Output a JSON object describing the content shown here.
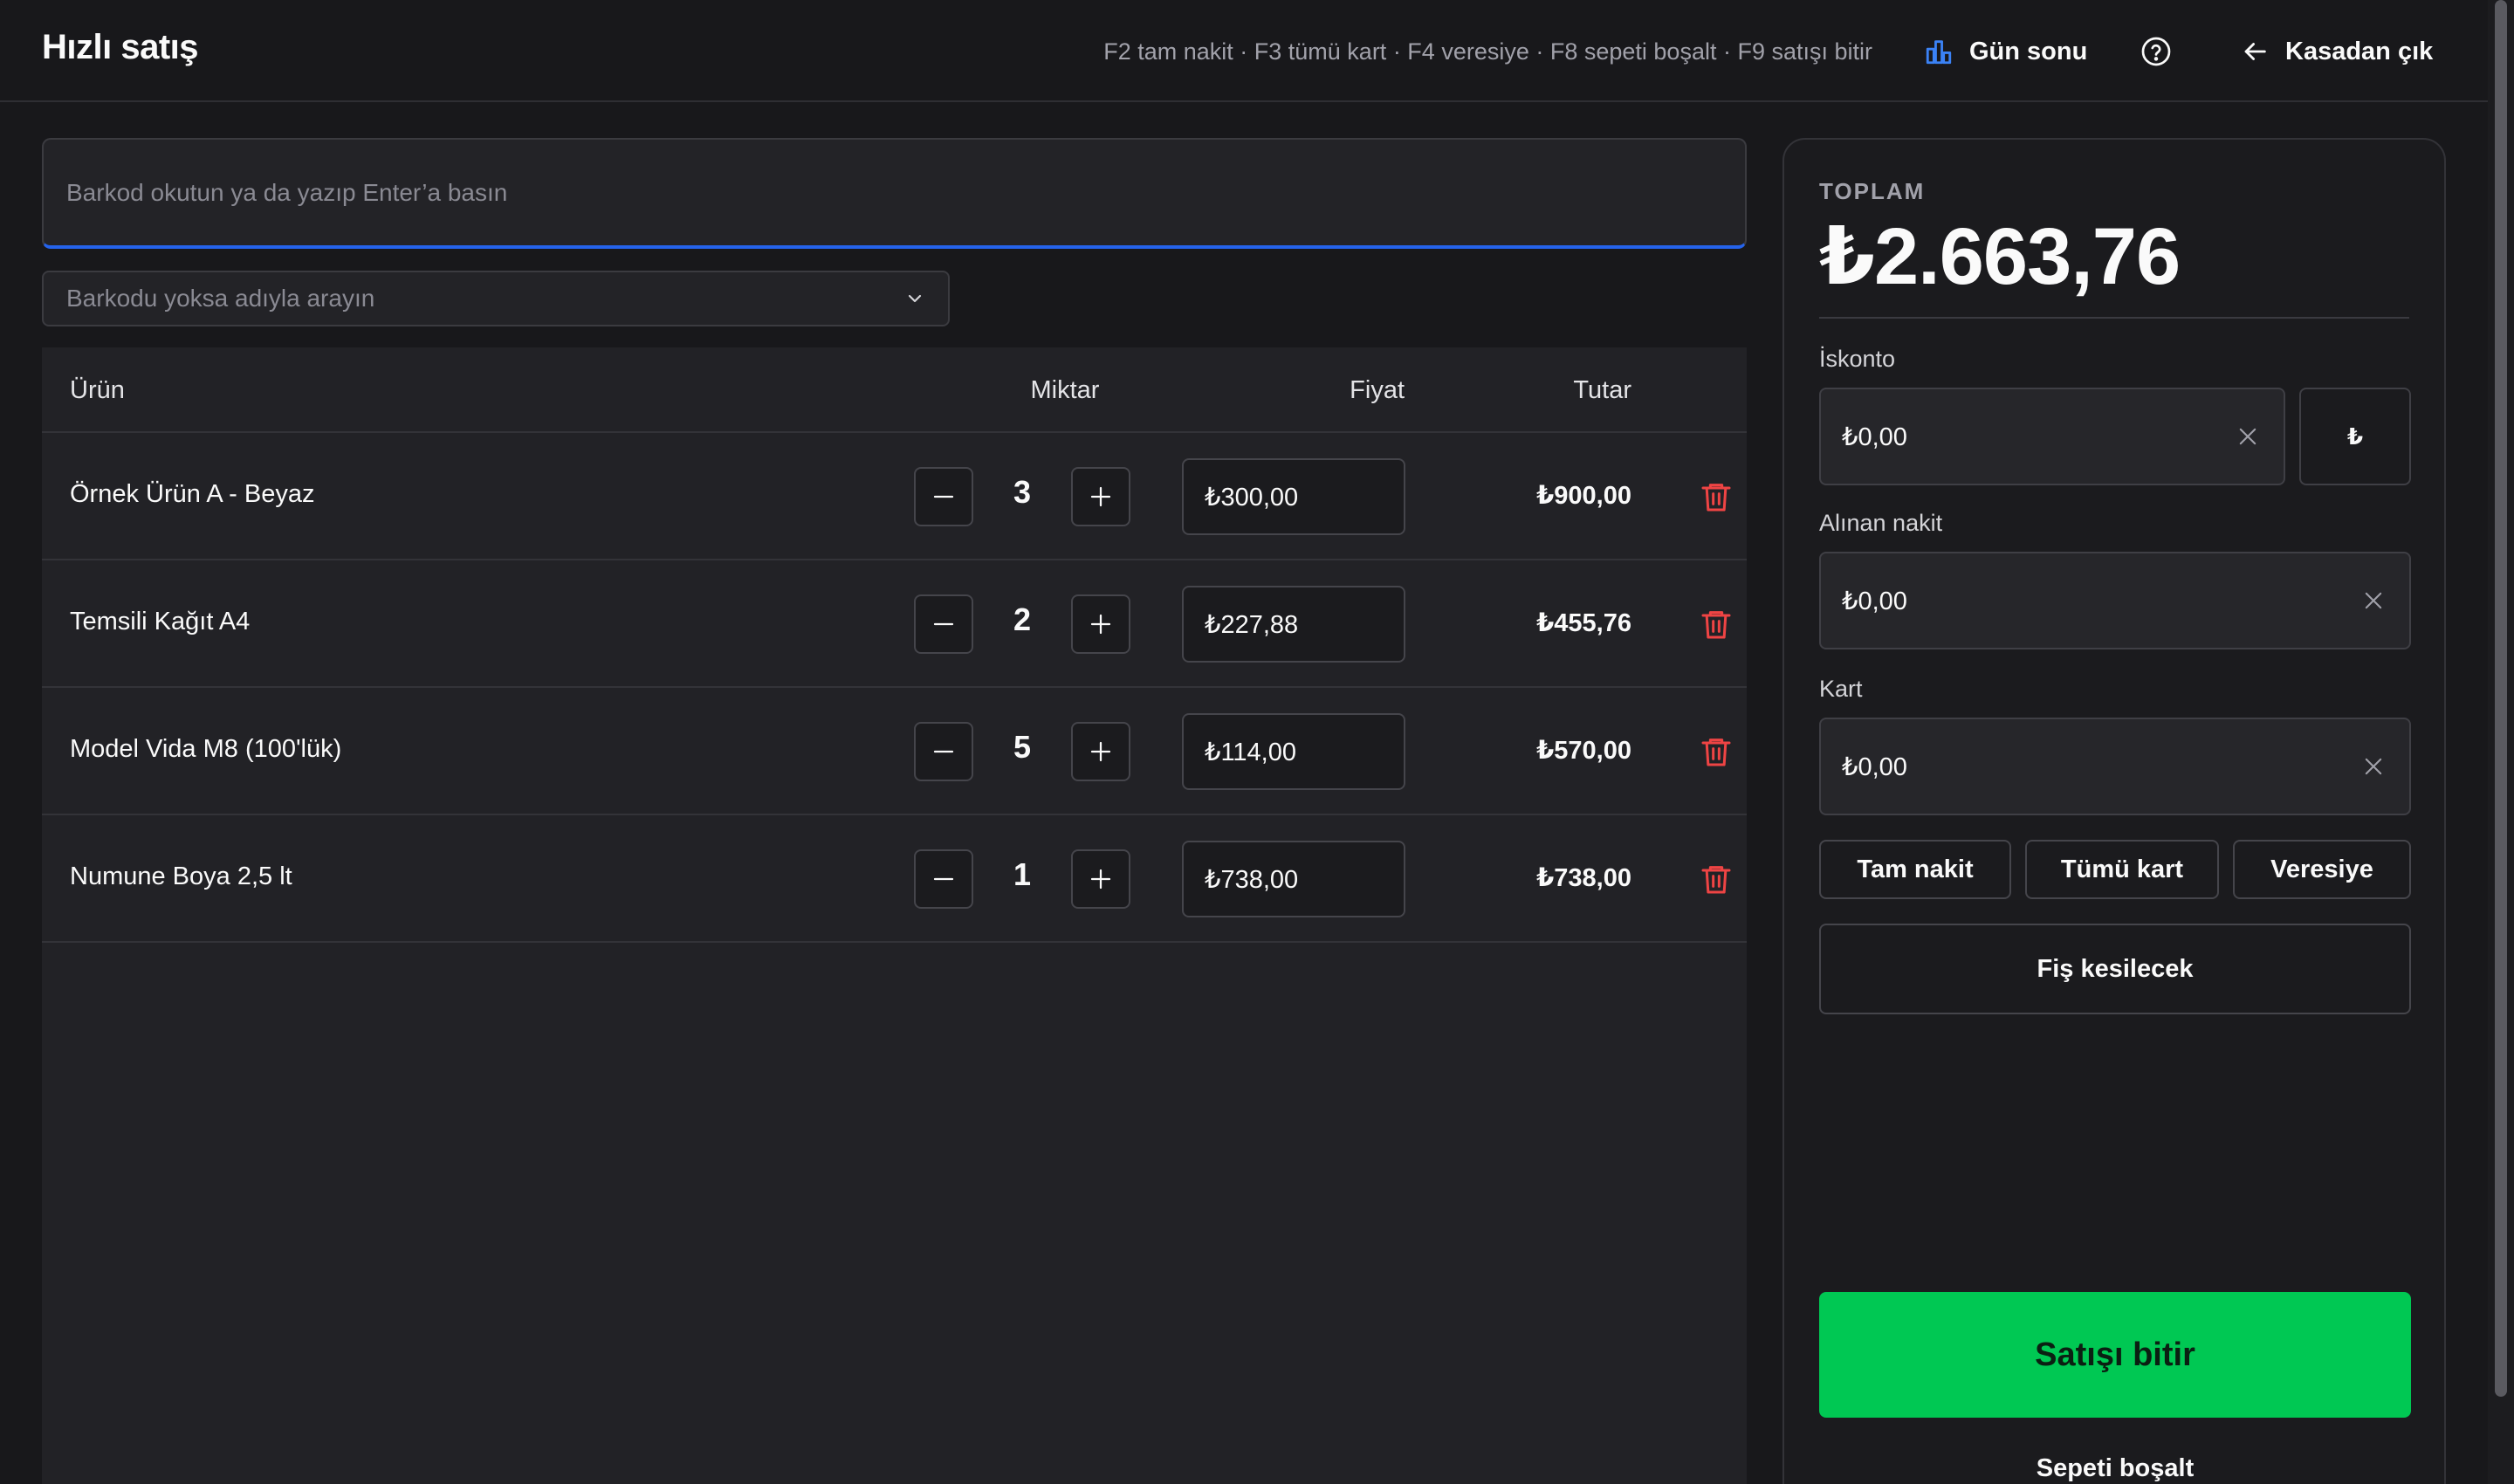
{
  "header": {
    "title": "Hızlı satış",
    "shortcuts": "F2 tam nakit · F3 tümü kart · F4 veresiye · F8 sepeti boşalt · F9 satışı bitir",
    "end_of_day": "Gün sonu",
    "exit": "Kasadan çık"
  },
  "search": {
    "barcode_placeholder": "Barkod okutun ya da yazıp Enter’a basın",
    "name_placeholder": "Barkodu yoksa adıyla arayın"
  },
  "table": {
    "headers": {
      "product": "Ürün",
      "quantity": "Miktar",
      "price": "Fiyat",
      "total": "Tutar"
    },
    "rows": [
      {
        "name": "Örnek Ürün A - Beyaz",
        "qty": "3",
        "price": "₺300,00",
        "total": "₺900,00"
      },
      {
        "name": "Temsili Kağıt A4",
        "qty": "2",
        "price": "₺227,88",
        "total": "₺455,76"
      },
      {
        "name": "Model Vida M8 (100'lük)",
        "qty": "5",
        "price": "₺114,00",
        "total": "₺570,00"
      },
      {
        "name": "Numune Boya 2,5 lt",
        "qty": "1",
        "price": "₺738,00",
        "total": "₺738,00"
      }
    ]
  },
  "summary": {
    "total_label": "TOPLAM",
    "total_value": "₺2.663,76",
    "discount_label": "İskonto",
    "discount_value": "₺0,00",
    "currency_toggle": "₺",
    "cash_label": "Alınan nakit",
    "cash_value": "₺0,00",
    "card_label": "Kart",
    "card_value": "₺0,00",
    "btn_full_cash": "Tam nakit",
    "btn_all_card": "Tümü kart",
    "btn_on_credit": "Veresiye",
    "receipt": "Fiş kesilecek",
    "finish": "Satışı bitir",
    "empty_cart": "Sepeti boşalt"
  },
  "colors": {
    "background": "#18181b",
    "accent_blue": "#2563eb",
    "finish_green": "#00c853",
    "delete_red": "#ef4444"
  },
  "icons": {
    "end_of_day": "bar-chart-icon",
    "help": "help-circle-icon",
    "exit": "arrow-left-icon",
    "delete": "trash-icon"
  }
}
